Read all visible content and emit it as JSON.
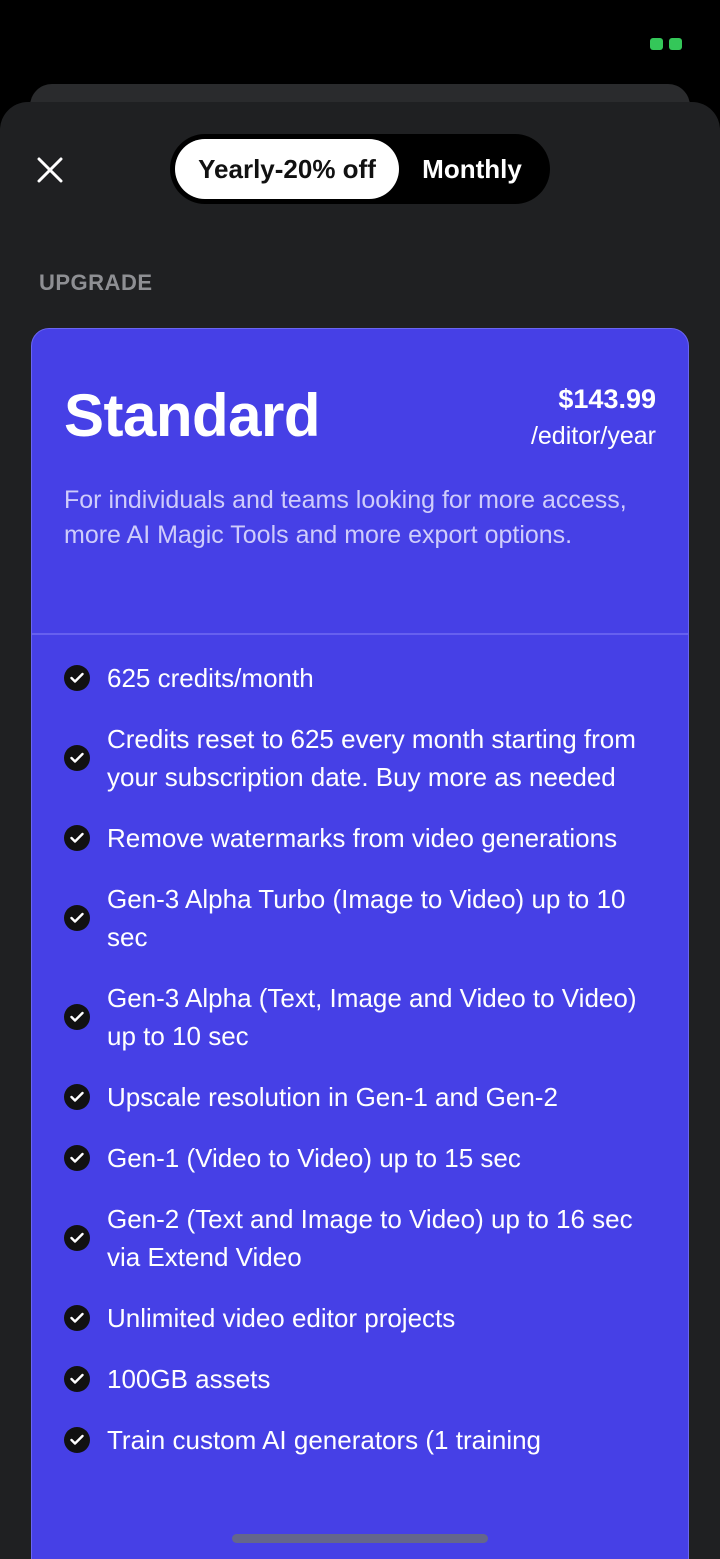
{
  "toggle": {
    "yearly_label": "Yearly-20% off",
    "monthly_label": "Monthly"
  },
  "section_label": "UPGRADE",
  "plan": {
    "name": "Standard",
    "price": "$143.99",
    "price_unit": "/editor/year",
    "description": "For individuals and teams looking for more access, more AI Magic Tools and more export options."
  },
  "features": [
    "625 credits/month",
    "Credits reset to 625 every month starting from your subscription date. Buy more as needed",
    "Remove watermarks from video generations",
    "Gen-3 Alpha Turbo (Image to Video) up to 10 sec",
    "Gen-3 Alpha (Text, Image and Video to Video) up to 10 sec",
    "Upscale resolution in Gen-1 and Gen-2",
    "Gen-1 (Video to Video) up to 15 sec",
    "Gen-2 (Text and Image to Video) up to 16 sec via Extend Video",
    "Unlimited video editor projects",
    "100GB assets",
    "Train custom AI generators (1 training"
  ],
  "colors": {
    "card": "#4640e6",
    "sheet": "#1f2022",
    "status": "#34c759"
  },
  "icons": {
    "close": "close-icon",
    "check": "check-circle-icon"
  }
}
